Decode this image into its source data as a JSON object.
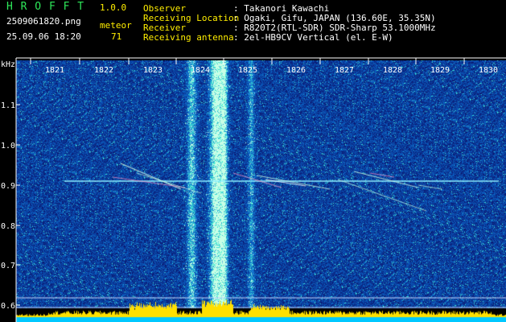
{
  "app": {
    "name": "H R O F F T",
    "version": "1.0.0",
    "filename": "2509061820.png",
    "datetime": "25.09.06 18:20",
    "meteor_label": "meteor",
    "meteor_count": "71"
  },
  "info": [
    {
      "label": "Observer",
      "value": ": Takanori Kawachi"
    },
    {
      "label": "Receiving Location",
      "value": ": Ogaki, Gifu, JAPAN (136.60E, 35.35N)"
    },
    {
      "label": "Receiver",
      "value": ": R820T2(RTL-SDR) SDR-Sharp 53.1000MHz"
    },
    {
      "label": "Receiving antenna",
      "value": ": 2el-HB9CV Vertical (el. E-W)"
    }
  ],
  "axis": {
    "y_unit": "kHz",
    "y_ticks": [
      "1.1",
      "1.0",
      "0.9",
      "0.8",
      "0.7",
      "0.6"
    ],
    "x_ticks": [
      "1821",
      "1822",
      "1823",
      "1824",
      "1825",
      "1826",
      "1827",
      "1828",
      "1829",
      "1830"
    ]
  },
  "colors": {
    "background": "#000000",
    "spectrum_bg": "#0a1a8a",
    "header_green": "#2ee85a",
    "header_yellow": "#ffee00",
    "carrier": "#8ff0ff",
    "noise_floor": "#ffe000",
    "baseline": "#00c8ff"
  }
}
